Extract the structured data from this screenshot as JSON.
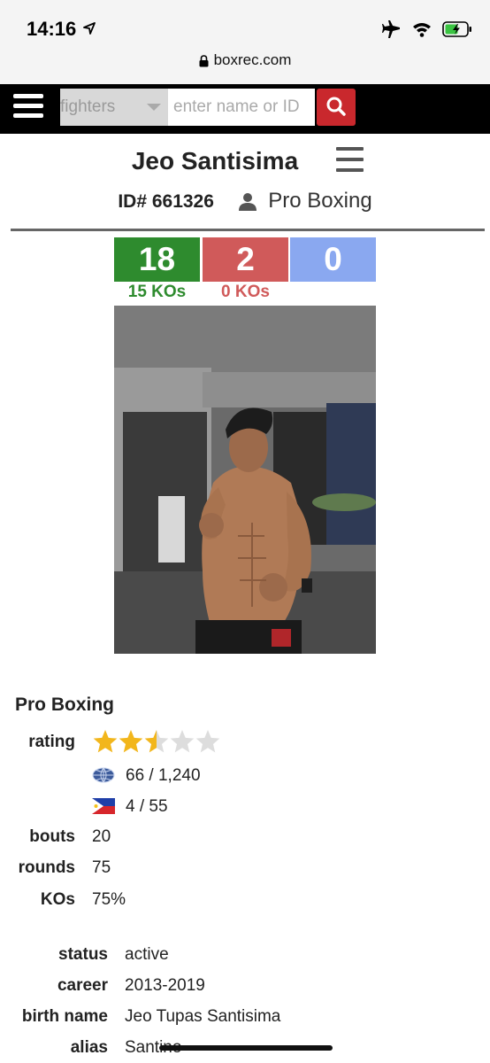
{
  "status_bar": {
    "time": "14:16",
    "url": "boxrec.com"
  },
  "header": {
    "search_type": "fighters",
    "search_placeholder": "enter name or ID"
  },
  "profile": {
    "name": "Jeo Santisima",
    "id_label": "ID# 661326",
    "category": "Pro Boxing",
    "record": {
      "wins": "18",
      "losses": "2",
      "draws": "0",
      "wins_ko": "15 KOs",
      "losses_ko": "0 KOs"
    }
  },
  "details": {
    "section": "Pro Boxing",
    "rating_label": "rating",
    "rating_stars": 2.5,
    "world_rank": "66 / 1,240",
    "country_rank": "4 / 55",
    "bouts_label": "bouts",
    "bouts": "20",
    "rounds_label": "rounds",
    "rounds": "75",
    "kos_label": "KOs",
    "kos": "75%",
    "status_label": "status",
    "status": "active",
    "career_label": "career",
    "career": "2013-2019",
    "birth_name_label": "birth name",
    "birth_name": "Jeo Tupas Santisima",
    "alias_label": "alias",
    "alias": "Santino"
  },
  "colors": {
    "win": "#2e8b2e",
    "loss": "#d05a5a",
    "draw": "#8aa8f0",
    "search_button": "#c9282d",
    "star": "#f2b61c"
  }
}
